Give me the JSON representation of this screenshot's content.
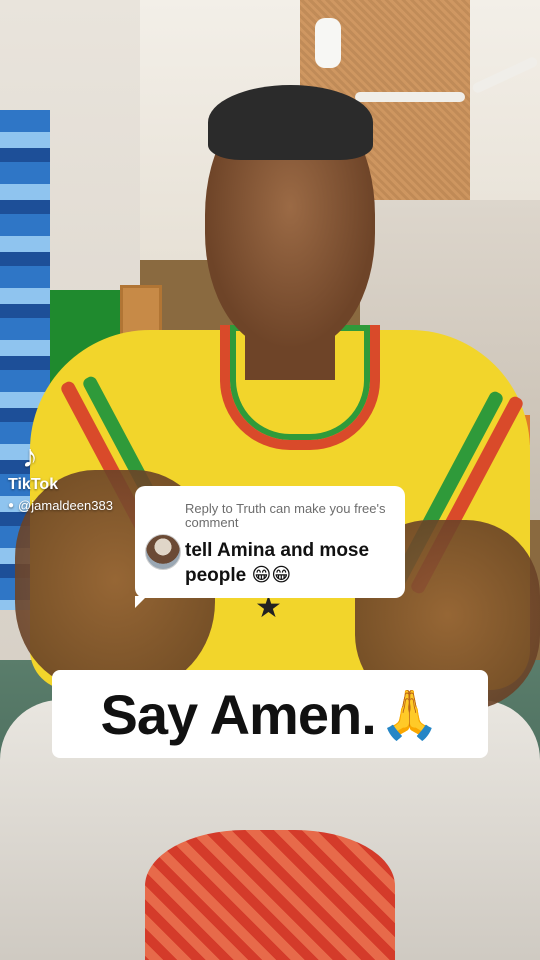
{
  "watermark": {
    "brand": "TikTok",
    "username": "@jamaldeen383",
    "logo_icon": "tiktok-note-icon",
    "user_icon": "person-icon"
  },
  "reply_card": {
    "header": "Reply to Truth can make you free's comment",
    "comment": "tell Amina and mose people 😁😁",
    "avatar_icon": "commenter-avatar"
  },
  "caption": {
    "text": "Say Amen.",
    "emoji": "🙏"
  },
  "colors": {
    "shirt": "#f2d52b",
    "stripe_red": "#d94a2a",
    "stripe_green": "#2f9a3a",
    "card_bg": "#ffffff"
  }
}
